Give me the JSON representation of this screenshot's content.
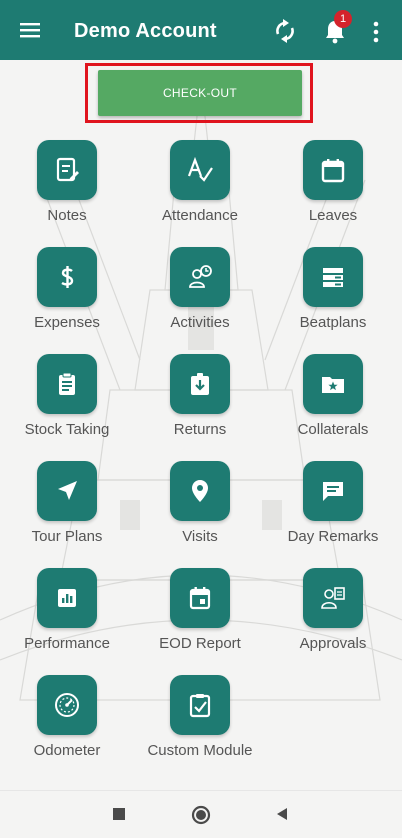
{
  "app_bar": {
    "title": "Demo Account",
    "notification_count": "1",
    "accent_color": "#1e7b72",
    "icons": [
      "menu-icon",
      "sync-icon",
      "bell-icon",
      "more-vert-icon"
    ]
  },
  "checkout": {
    "label": "CHECK-OUT",
    "button_color": "#55a963",
    "highlight_color": "#e0141e"
  },
  "modules": [
    {
      "label": "Notes",
      "icon": "notes-icon"
    },
    {
      "label": "Attendance",
      "icon": "attendance-icon"
    },
    {
      "label": "Leaves",
      "icon": "calendar-icon"
    },
    {
      "label": "Expenses",
      "icon": "dollar-icon"
    },
    {
      "label": "Activities",
      "icon": "activities-icon"
    },
    {
      "label": "Beatplans",
      "icon": "beatplans-icon"
    },
    {
      "label": "Stock Taking",
      "icon": "clipboard-icon"
    },
    {
      "label": "Returns",
      "icon": "returns-icon"
    },
    {
      "label": "Collaterals",
      "icon": "folder-star-icon"
    },
    {
      "label": "Tour Plans",
      "icon": "navigation-icon"
    },
    {
      "label": "Visits",
      "icon": "location-pin-icon"
    },
    {
      "label": "Day Remarks",
      "icon": "comment-icon"
    },
    {
      "label": "Performance",
      "icon": "bar-chart-icon"
    },
    {
      "label": "EOD Report",
      "icon": "event-icon"
    },
    {
      "label": "Approvals",
      "icon": "approvals-icon"
    },
    {
      "label": "Odometer",
      "icon": "odometer-icon"
    },
    {
      "label": "Custom Module",
      "icon": "custom-module-icon"
    }
  ],
  "system_nav": {
    "icons": [
      "recents-square-icon",
      "home-circle-icon",
      "back-triangle-icon"
    ]
  }
}
